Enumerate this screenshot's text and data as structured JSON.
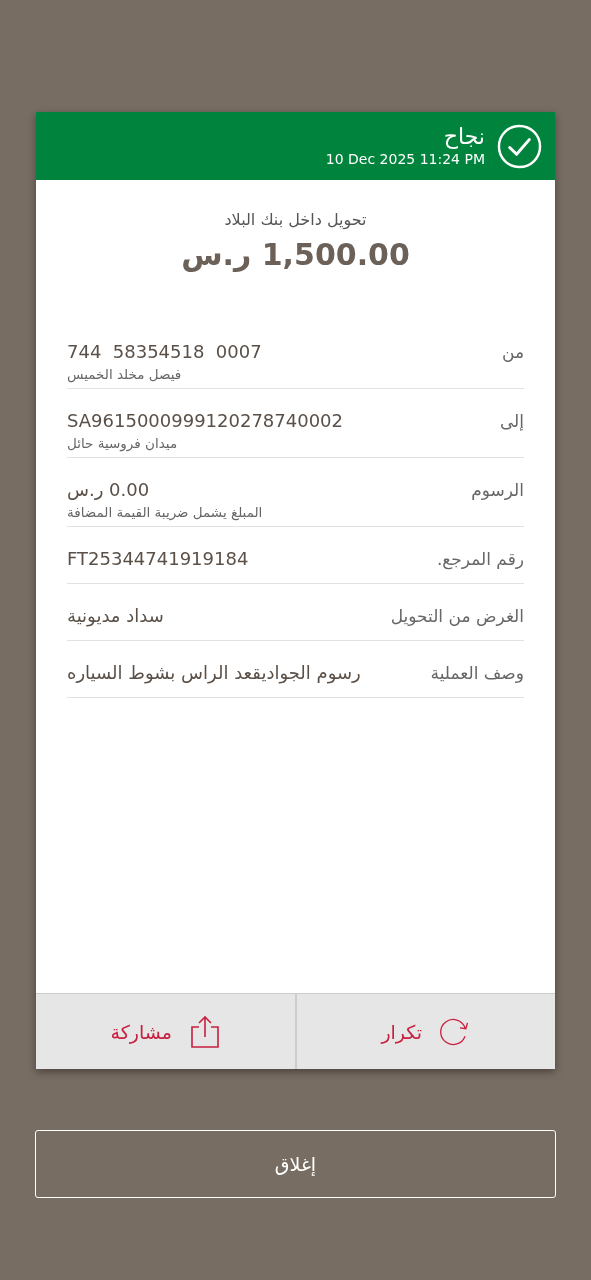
{
  "header": {
    "status": "نجاح",
    "datetime": "10 Dec 2025 11:24 PM",
    "kind": "success"
  },
  "transfer_type": "تحويل داخل بنك البلاد",
  "amount": "1,500.00 ر.س",
  "details": [
    {
      "label": "من",
      "value": "744  58354518  0007",
      "subtitle": "فيصل مخلد الخميس"
    },
    {
      "label": "إلى",
      "value": "SA9615000999120278740002",
      "subtitle": "ميدان فروسية حائل"
    },
    {
      "label": "الرسوم",
      "value": "0.00 ر.س",
      "subtitle": "المبلغ يشمل ضريبة القيمة المضافة"
    },
    {
      "label": "رقم المرجع.",
      "value": "FT25344741919184"
    },
    {
      "label": "الغرض من التحويل",
      "value": "سداد مديونية"
    },
    {
      "label": "وصف العملية",
      "value": "رسوم الجواديقعد الراس بشوط السياره"
    }
  ],
  "actions": [
    {
      "kind": "repeat",
      "label": "تكرار"
    },
    {
      "kind": "share",
      "label": "مشاركة"
    }
  ],
  "close_button": "إغلاق"
}
